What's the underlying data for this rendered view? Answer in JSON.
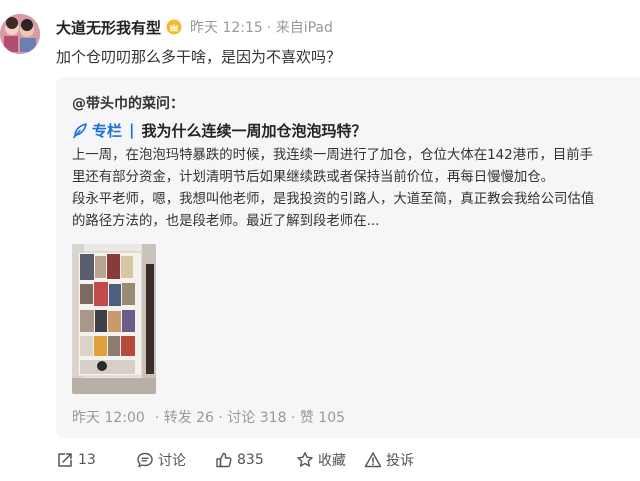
{
  "post": {
    "author": "大道无形我有型",
    "time": "昨天 12:15",
    "source": "· 来自iPad",
    "text": "加个仓叨叨那么多干啥，是因为不喜欢吗？"
  },
  "quote": {
    "user": "@带头巾的菜问：",
    "column_label": "专栏",
    "separator": "|",
    "title": "我为什么连续一周加仓泡泡玛特？",
    "body_lines": [
      "上一周，在泡泡玛特暴跌的时候，我连续一周进行了加仓，仓位大体在142港币，目前手",
      "里还有部分资金，计划清明节后如果继续跌或者保持当前价位，再每日慢慢加仓。",
      "段永平老师，嗯，我想叫他老师，是我投资的引路人，大道至简，真正教会我给公司估值",
      "的路径方法的，也是段老师。最近了解到段老师在..."
    ],
    "footer": {
      "time": "昨天 12:00",
      "stats": "· 转发 26 · 讨论 318 · 赞 105"
    }
  },
  "actions": {
    "repost": "13",
    "comment": "讨论",
    "like": "835",
    "favorite": "收藏",
    "report": "投诉"
  },
  "icons": {
    "badge": "gold-crown-badge-icon",
    "column": "column-quill-icon",
    "repost": "repost-icon",
    "comment": "comment-icon",
    "like": "thumbs-up-icon",
    "favorite": "star-icon",
    "report": "warning-icon"
  },
  "colors": {
    "accent": "#1e6fdd",
    "muted": "#999999",
    "card_bg": "#f6f6f8"
  }
}
